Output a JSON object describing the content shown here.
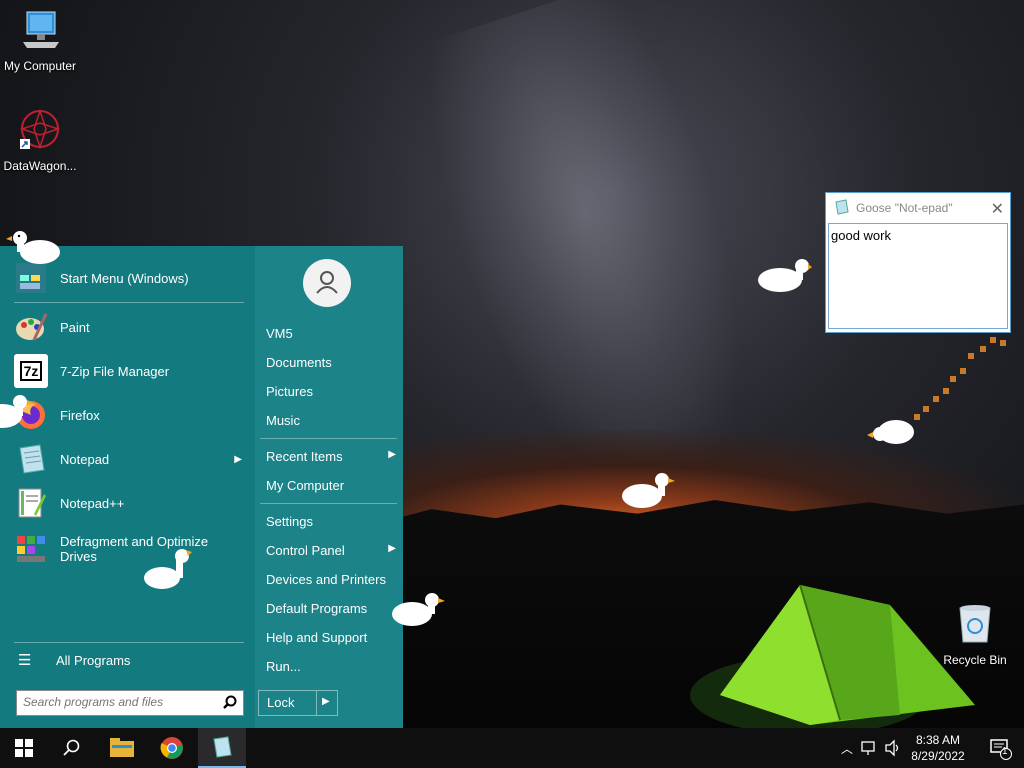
{
  "desktop": {
    "icons": [
      {
        "label": "My Computer",
        "icon": "computer-icon"
      },
      {
        "label": "DataWagon...",
        "icon": "datawagon-icon"
      },
      {
        "label": "Recycle Bin",
        "icon": "recycle-bin-icon"
      }
    ]
  },
  "start_menu": {
    "apps": [
      {
        "label": "Start Menu (Windows)",
        "icon": "start-menu-app-icon"
      },
      {
        "label": "Paint",
        "icon": "paint-icon"
      },
      {
        "label": "7-Zip File Manager",
        "icon": "7zip-icon",
        "icon_text": "7z"
      },
      {
        "label": "Firefox",
        "icon": "firefox-icon"
      },
      {
        "label": "Notepad",
        "icon": "notepad-icon",
        "has_submenu": true
      },
      {
        "label": "Notepad++",
        "icon": "notepadpp-icon"
      },
      {
        "label": "Defragment and Optimize",
        "label2": "Drives",
        "icon": "defrag-icon"
      }
    ],
    "all_programs": "All Programs",
    "search_placeholder": "Search programs and files",
    "right": [
      {
        "label": "VM5"
      },
      {
        "label": "Documents"
      },
      {
        "label": "Pictures"
      },
      {
        "label": "Music"
      },
      {
        "label": "Recent Items",
        "has_submenu": true
      },
      {
        "label": "My Computer"
      },
      {
        "label": "Settings"
      },
      {
        "label": "Control Panel",
        "has_submenu": true
      },
      {
        "label": "Devices and Printers"
      },
      {
        "label": "Default Programs"
      },
      {
        "label": "Help and Support"
      },
      {
        "label": "Run..."
      }
    ],
    "lock": "Lock"
  },
  "notepad": {
    "title": "Goose \"Not-epad\"",
    "text": "good work"
  },
  "taskbar": {
    "pinned": [
      "windows-start-icon",
      "search-icon",
      "file-explorer-icon",
      "chrome-icon",
      "notepad-icon"
    ],
    "time": "8:38 AM",
    "date": "8/29/2022",
    "notification_count": "1"
  },
  "colors": {
    "start_menu_bg": "#137b80",
    "taskbar_bg": "#0f0f10",
    "accent": "#2b8fd6"
  }
}
